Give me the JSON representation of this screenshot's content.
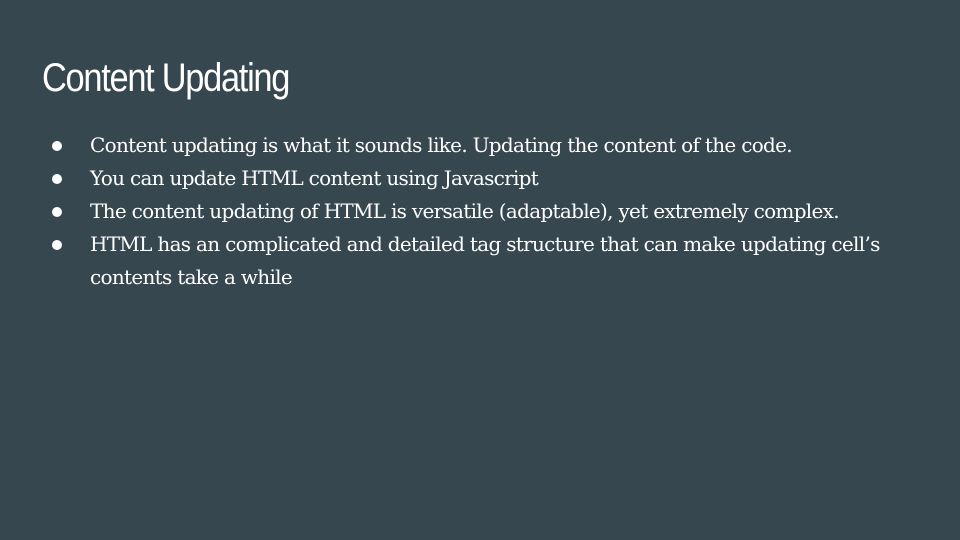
{
  "slide": {
    "title": "Content Updating",
    "bullets": [
      "Content updating is what it sounds like. Updating the content of the code.",
      "You can update HTML content using Javascript",
      "The content updating of HTML is versatile (adaptable), yet extremely complex.",
      "HTML has an complicated and detailed tag structure that can make updating cell’s contents take a while"
    ]
  },
  "colors": {
    "background": "#37474f",
    "text": "#ffffff"
  }
}
